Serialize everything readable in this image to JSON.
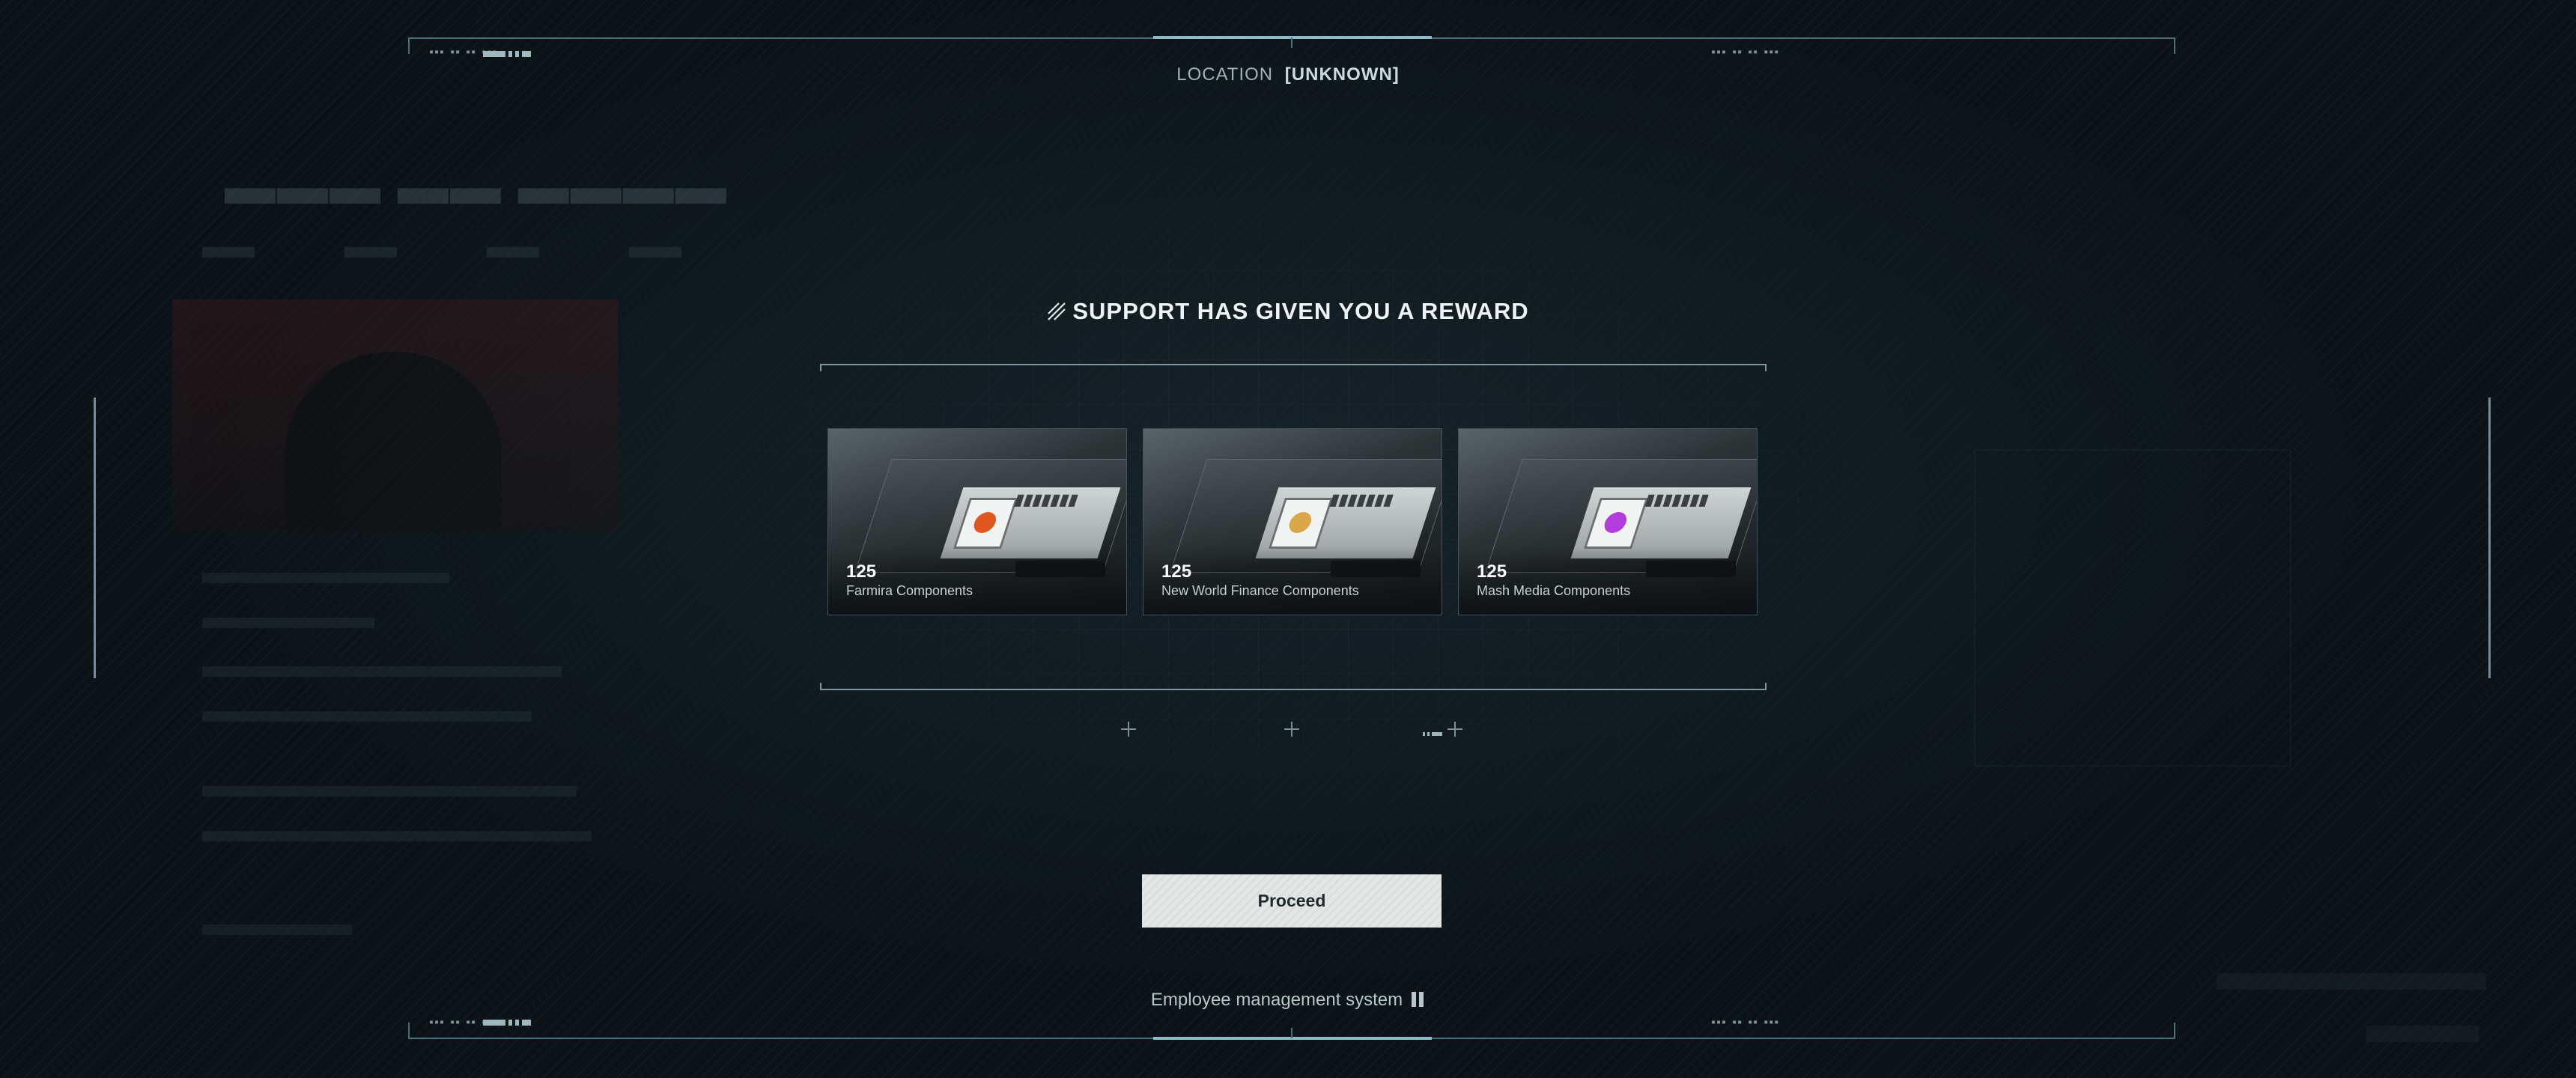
{
  "header": {
    "location_label": "LOCATION",
    "location_value": "[UNKNOWN]"
  },
  "reward": {
    "title": "SUPPORT HAS GIVEN YOU A REWARD",
    "items": [
      {
        "amount": "125",
        "name": "Farmira Components",
        "emblem_color": "#e0561f"
      },
      {
        "amount": "125",
        "name": "New World Finance Components",
        "emblem_color": "#d9a64a"
      },
      {
        "amount": "125",
        "name": "Mash Media Components",
        "emblem_color": "#b23ddc"
      }
    ]
  },
  "actions": {
    "proceed_label": "Proceed"
  },
  "footer": {
    "system_label": "Employee management system"
  },
  "colors": {
    "background": "#0b1317",
    "frame": "#4e6d78",
    "accent": "#8fb9c6",
    "button_bg": "#e4e6e5"
  }
}
